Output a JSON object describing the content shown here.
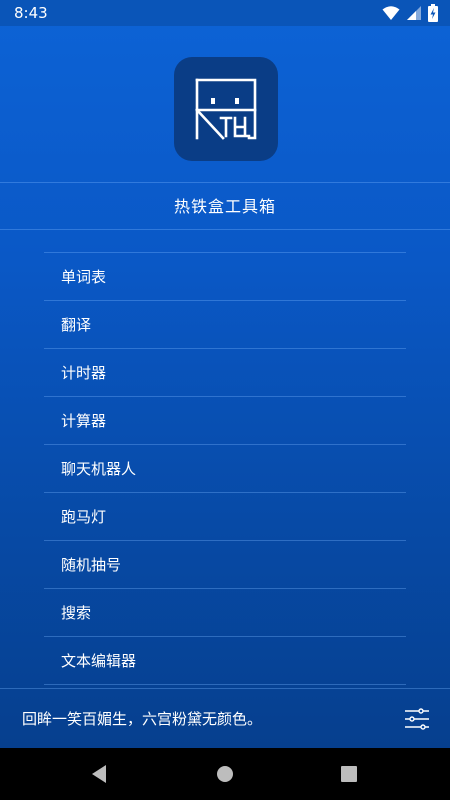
{
  "status_bar": {
    "time": "8:43",
    "icons": [
      "wifi-icon",
      "signal-icon",
      "battery-charging-icon"
    ]
  },
  "header": {
    "app_icon": "toolbox-logo-icon",
    "title": "热铁盒工具箱"
  },
  "menu": {
    "items": [
      {
        "label": "单词表"
      },
      {
        "label": "翻译"
      },
      {
        "label": "计时器"
      },
      {
        "label": "计算器"
      },
      {
        "label": "聊天机器人"
      },
      {
        "label": "跑马灯"
      },
      {
        "label": "随机抽号"
      },
      {
        "label": "搜索"
      },
      {
        "label": "文本编辑器"
      }
    ]
  },
  "footer": {
    "quote": "回眸一笑百媚生，六宫粉黛无颜色。",
    "settings_icon": "sliders-icon"
  },
  "nav_bar": {
    "buttons": [
      "back-icon",
      "home-icon",
      "recents-icon"
    ]
  },
  "colors": {
    "background_top": "#0d63d6",
    "background_bottom": "#063f8e",
    "icon_bg": "#0a3d86",
    "divider": "#78b4ff"
  }
}
